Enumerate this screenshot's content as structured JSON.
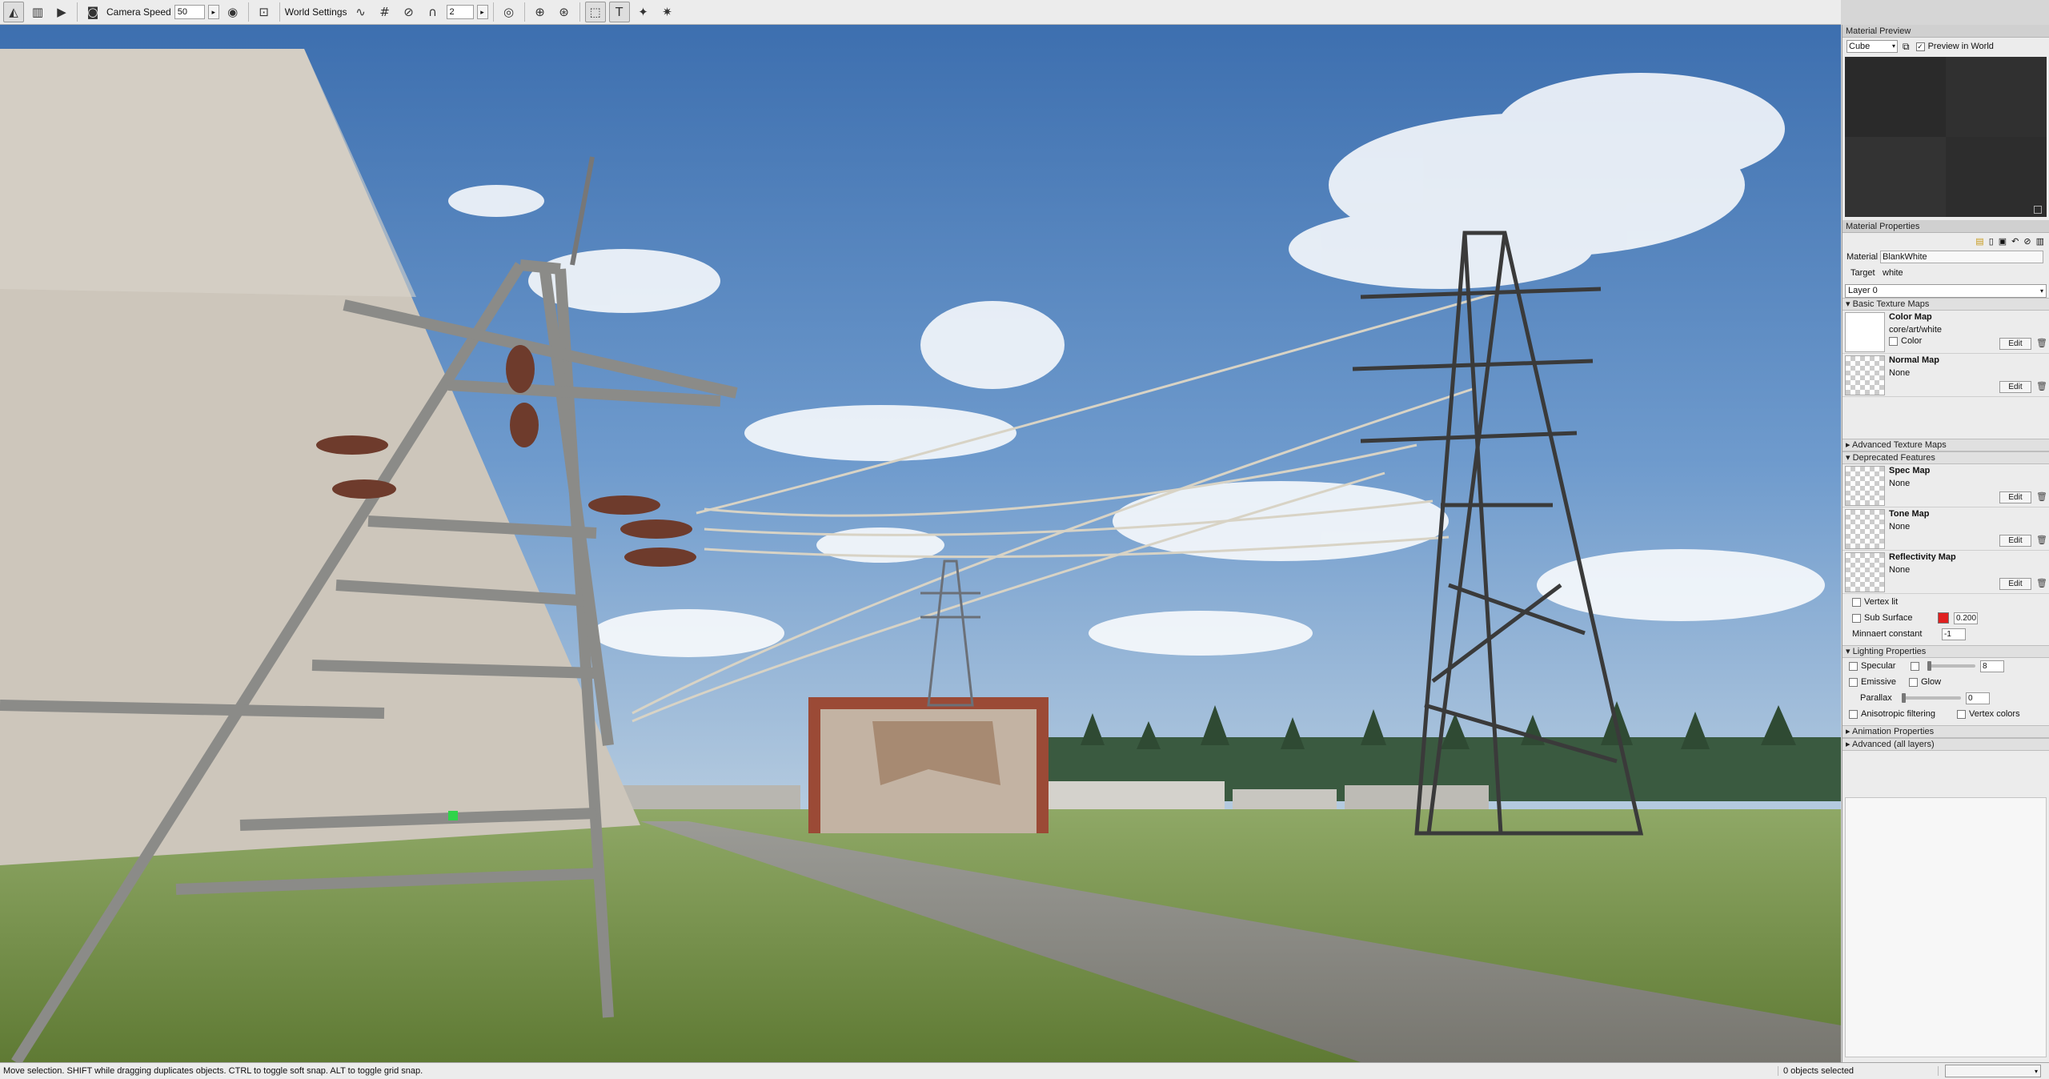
{
  "toolbar": {
    "camera_speed_label": "Camera Speed",
    "camera_speed_value": "50",
    "world_settings_label": "World Settings",
    "snap_value": "2"
  },
  "material_preview": {
    "title": "Material Preview",
    "shape_select": "Cube",
    "preview_in_world_label": "Preview in World",
    "preview_in_world_checked": true
  },
  "material_properties": {
    "title": "Material Properties",
    "material_label": "Material",
    "material_value": "BlankWhite",
    "target_label": "Target",
    "target_value": "white",
    "layer_select": "Layer 0",
    "sections": {
      "basic_texture_maps": "Basic Texture Maps",
      "advanced_texture_maps": "Advanced Texture Maps",
      "deprecated_features": "Deprecated Features",
      "lighting_properties": "Lighting Properties",
      "animation_properties": "Animation Properties",
      "advanced_all_layers": "Advanced (all layers)"
    },
    "basic_maps": [
      {
        "name": "Color Map",
        "value": "core/art/white",
        "extra": "Color",
        "edit": "Edit"
      },
      {
        "name": "Normal Map",
        "value": "None",
        "extra": "",
        "edit": "Edit"
      }
    ],
    "deprecated_maps": [
      {
        "name": "Spec Map",
        "value": "None",
        "edit": "Edit"
      },
      {
        "name": "Tone Map",
        "value": "None",
        "edit": "Edit"
      },
      {
        "name": "Reflectivity Map",
        "value": "None",
        "edit": "Edit"
      }
    ],
    "vertex_lit_label": "Vertex lit",
    "sub_surface_label": "Sub Surface",
    "sub_surface_color": "#e02020",
    "sub_surface_value": "0.200",
    "minnaert_label": "Minnaert constant",
    "minnaert_value": "-1",
    "lighting": {
      "specular_label": "Specular",
      "specular_value": "8",
      "emissive_label": "Emissive",
      "glow_label": "Glow",
      "parallax_label": "Parallax",
      "parallax_value": "0",
      "anisotropic_label": "Anisotropic filtering",
      "vertex_colors_label": "Vertex colors"
    }
  },
  "status": {
    "message": "Move selection.  SHIFT while dragging duplicates objects.  CTRL to toggle soft snap.  ALT to toggle grid snap.",
    "selection": "0 objects selected"
  },
  "colors": {
    "sky_top": "#3b72b3",
    "sky_bottom": "#a9c4dd",
    "grass": "#7e9a4e",
    "road": "#8a8a86"
  }
}
